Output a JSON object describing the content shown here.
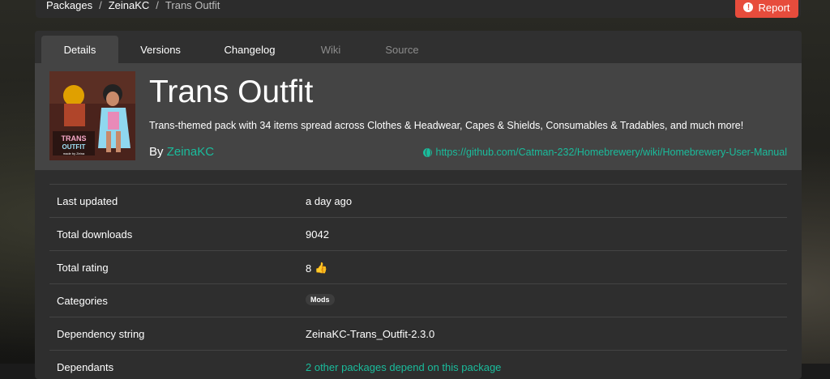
{
  "breadcrumb": {
    "items": [
      "Packages",
      "ZeinaKC",
      "Trans Outfit"
    ],
    "separator": "/"
  },
  "report_button": {
    "label": "Report",
    "color": "#e74c3c"
  },
  "tabs": [
    {
      "label": "Details",
      "state": "active"
    },
    {
      "label": "Versions",
      "state": "enabled"
    },
    {
      "label": "Changelog",
      "state": "enabled"
    },
    {
      "label": "Wiki",
      "state": "disabled"
    },
    {
      "label": "Source",
      "state": "disabled"
    }
  ],
  "package": {
    "title": "Trans Outfit",
    "description": "Trans-themed pack with 34 items spread across Clothes & Headwear, Capes & Shields, Consumables & Tradables, and much more!",
    "by_label": "By",
    "author": "ZeinaKC",
    "website": "https://github.com/Catman-232/Homebrewery/wiki/Homebrewery-User-Manual",
    "icon_text": "TRANS OUTFIT",
    "icon_subtext": "made by Zeina"
  },
  "details": {
    "last_updated": {
      "label": "Last updated",
      "value": "a day ago"
    },
    "total_downloads": {
      "label": "Total downloads",
      "value": "9042"
    },
    "total_rating": {
      "label": "Total rating",
      "value": "8"
    },
    "categories": {
      "label": "Categories",
      "badge": "Mods"
    },
    "dependency_string": {
      "label": "Dependency string",
      "value": "ZeinaKC-Trans_Outfit-2.3.0"
    },
    "dependents": {
      "label": "Dependants",
      "value": "2 other packages depend on this package"
    }
  },
  "colors": {
    "accent": "#1abc9c",
    "card": "#2e2e2e",
    "header": "#444444"
  }
}
